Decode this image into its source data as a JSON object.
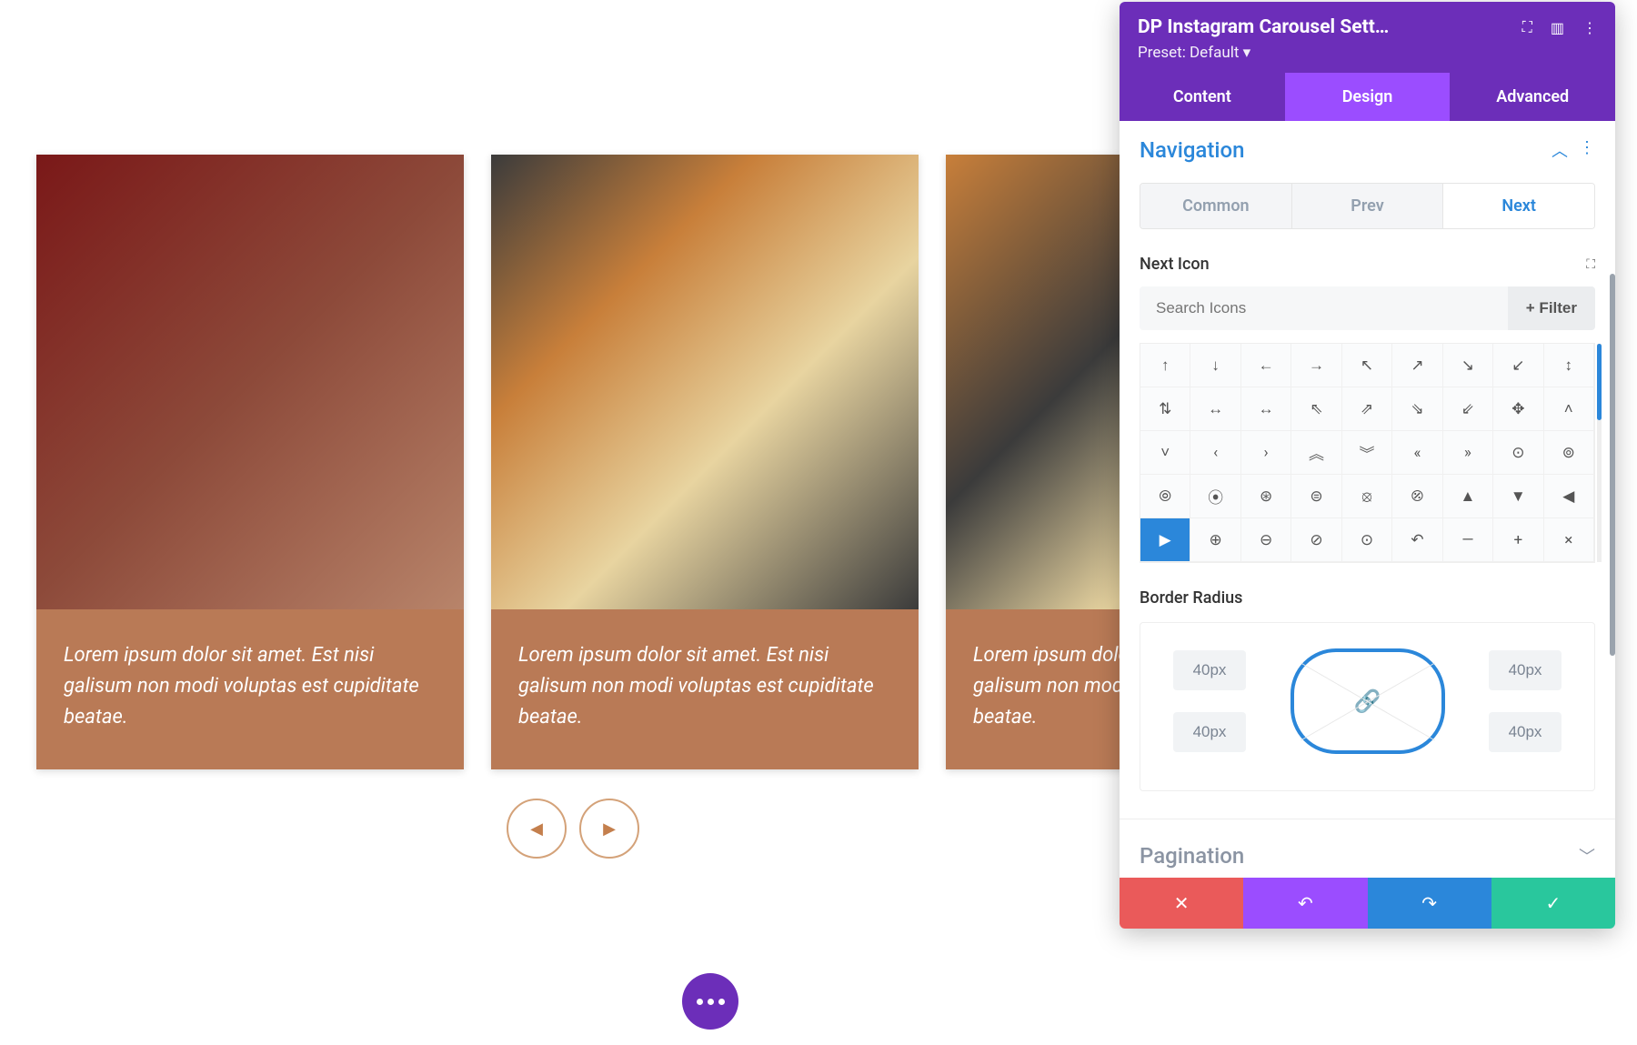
{
  "preview": {
    "cards": [
      {
        "caption": "Lorem ipsum dolor sit amet. Est nisi galisum non modi voluptas est cupiditate beatae."
      },
      {
        "caption": "Lorem ipsum dolor sit amet. Est nisi galisum non modi voluptas est cupiditate beatae."
      },
      {
        "caption": "Lorem ipsum dolor sit amet. Est nisi galisum non modi voluptas est cupiditate beatae."
      }
    ]
  },
  "panel": {
    "title": "DP Instagram Carousel Sett…",
    "preset": "Preset: Default ▾",
    "tabs": {
      "content": "Content",
      "design": "Design",
      "advanced": "Advanced"
    },
    "section_nav": "Navigation",
    "sub_tabs": {
      "common": "Common",
      "prev": "Prev",
      "next": "Next"
    },
    "next_icon_label": "Next Icon",
    "search_placeholder": "Search Icons",
    "filter_label": "+  Filter",
    "icon_rows": [
      [
        "↑",
        "↓",
        "←",
        "→",
        "↖",
        "↗",
        "↘",
        "↙",
        "↕"
      ],
      [
        "⇅",
        "↔",
        "↔",
        "⇖",
        "⇗",
        "⇘",
        "⇙",
        "✥",
        "˄"
      ],
      [
        "˅",
        "‹",
        "›",
        "︽",
        "︾",
        "«",
        "»",
        "⊙",
        "⊚"
      ],
      [
        "⦾",
        "⦿",
        "⊛",
        "⊜",
        "⦻",
        "⦼",
        "▲",
        "▼",
        "◀"
      ],
      [
        "▶",
        "⊕",
        "⊖",
        "⊘",
        "⊙",
        "↶",
        "—",
        "+",
        "×"
      ]
    ],
    "selected_icon_row": 4,
    "selected_icon_col": 0,
    "border_radius_label": "Border Radius",
    "border_radius": {
      "tl": "40px",
      "tr": "40px",
      "bl": "40px",
      "br": "40px"
    },
    "section_pagination": "Pagination"
  }
}
